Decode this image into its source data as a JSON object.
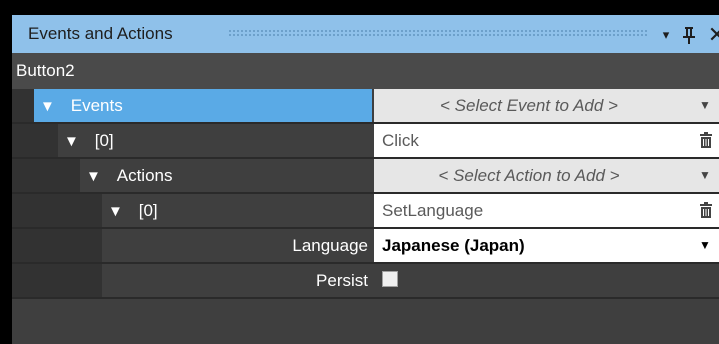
{
  "panel": {
    "title": "Events and Actions",
    "object_name": "Button2",
    "buttons": {
      "dropdown": "▾",
      "pin": "ꟼ",
      "close": "✕"
    }
  },
  "grid": {
    "rows": [
      {
        "label": "Events",
        "value": "< Select Event to Add >",
        "kind": "combo-placeholder"
      },
      {
        "label": "[0]",
        "value": "Click",
        "kind": "deletable"
      },
      {
        "label": "Actions",
        "value": "< Select Action to Add >",
        "kind": "combo-placeholder"
      },
      {
        "label": "[0]",
        "value": "SetLanguage",
        "kind": "deletable"
      },
      {
        "label": "Language",
        "value": "Japanese (Japan)",
        "kind": "combo"
      },
      {
        "label": "Persist",
        "value": "",
        "kind": "checkbox",
        "checked": false
      }
    ],
    "expander_glyph": "▼",
    "dropdown_glyph": "▼"
  },
  "colors": {
    "title_bar": "#8fc1ea",
    "selected_row": "#5aaae6",
    "grid_background": "#3f3f3f",
    "subheader": "#4a4a4a"
  }
}
